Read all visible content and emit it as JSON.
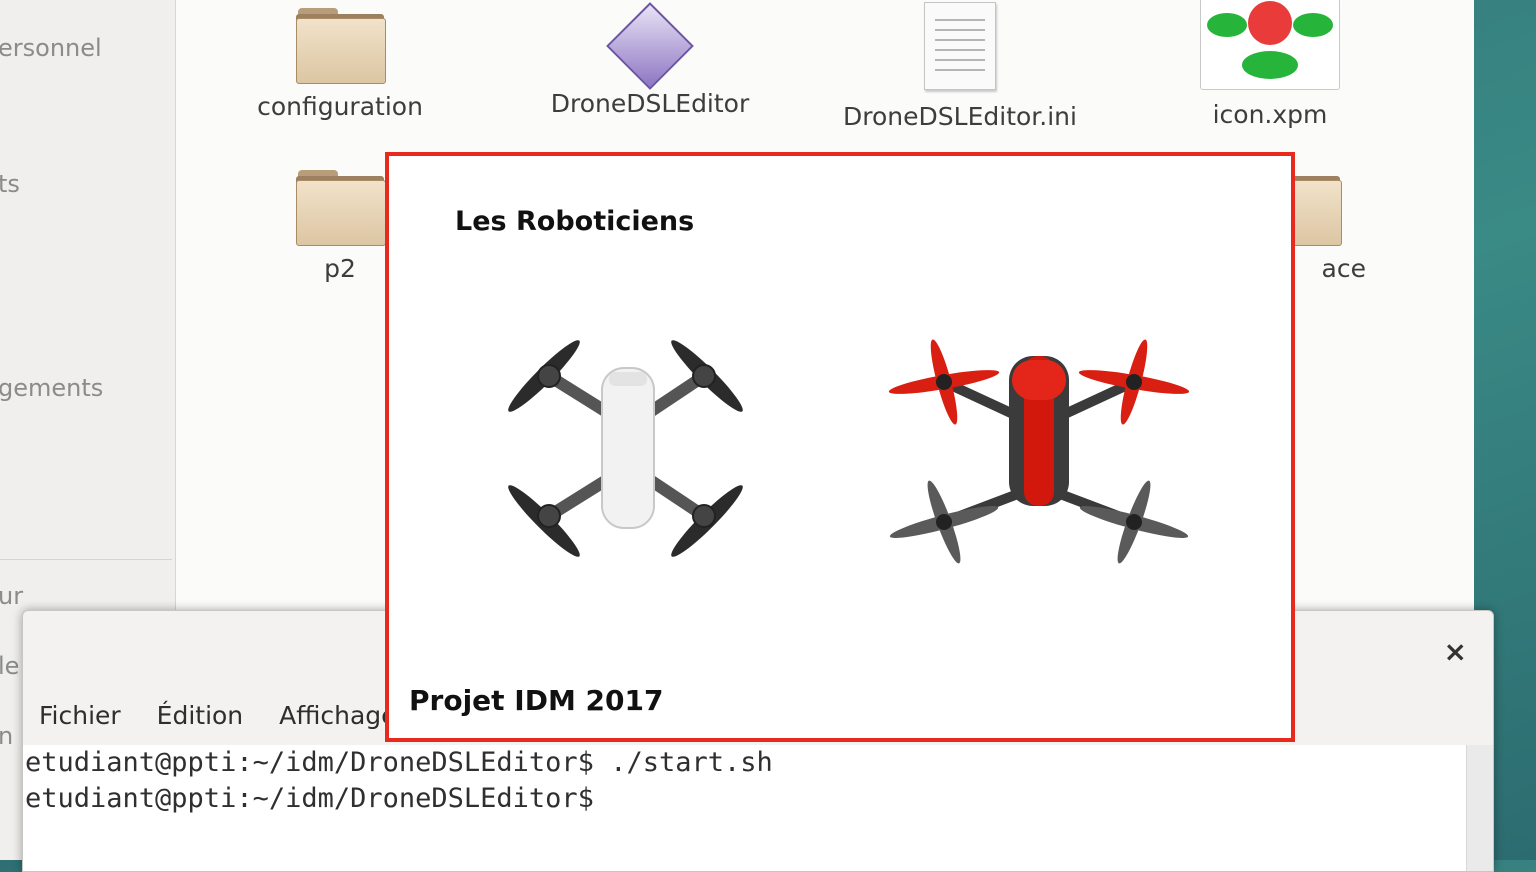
{
  "sidebar": {
    "items": [
      "ersonnel",
      "ts",
      "gements",
      "ur",
      "le",
      "n"
    ]
  },
  "files": [
    {
      "name": "configuration",
      "icon": "folder-icon"
    },
    {
      "name": "DroneDSLEditor",
      "icon": "executable-icon"
    },
    {
      "name": "DroneDSLEditor.ini",
      "icon": "text-file-icon"
    },
    {
      "name": "icon.xpm",
      "icon": "image-file-icon"
    },
    {
      "name": "p2",
      "icon": "folder-icon"
    },
    {
      "name": "ace",
      "icon": "folder-icon"
    }
  ],
  "terminal": {
    "menu": [
      "Fichier",
      "Édition",
      "Affichage"
    ],
    "lines": [
      "etudiant@ppti:~/idm/DroneDSLEditor$ ./start.sh",
      "etudiant@ppti:~/idm/DroneDSLEditor$"
    ],
    "close_label": "×"
  },
  "splash": {
    "title": "Les Roboticiens",
    "footer": "Projet IDM 2017",
    "border_color": "#e8291d"
  }
}
